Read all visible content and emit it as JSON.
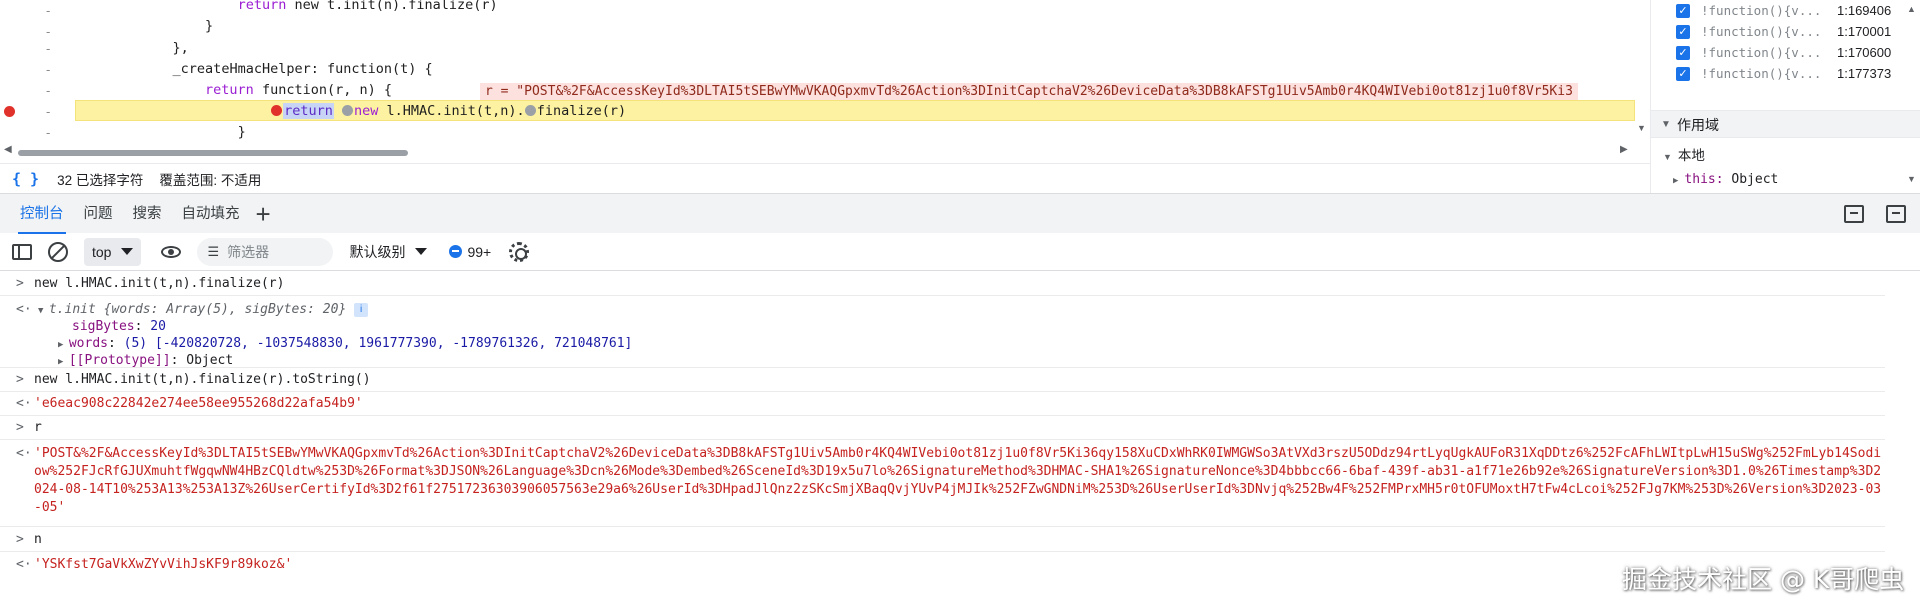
{
  "editor": {
    "lines": [
      {
        "code_pre": "                    ",
        "kw": "return",
        "code_post": " new t.init(n).finalize(r)"
      },
      {
        "code_pre": "                ",
        "kw": "",
        "code_post": "}"
      },
      {
        "code_pre": "            ",
        "kw": "",
        "code_post": "},"
      },
      {
        "code_pre": "            ",
        "kw": "",
        "code_post": "_createHmacHelper: function(t) {"
      },
      {
        "code_pre": "                ",
        "kw": "return",
        "code_post": " function(r, n) {"
      },
      {
        "code_pre": "",
        "kw": "",
        "code_post": "}"
      }
    ],
    "inline_value": "r = \"POST&%2F&AccessKeyId%3DLTAI5tSEBwYMwVKAQGpxmvTd%26Action%3DInitCaptchaV2%26DeviceData%3DB8kAFSTg1Uiv5Amb0r4KQ4WIVebi0ot81zj1u0f8Vr5Ki3",
    "current_line": {
      "kw": "return",
      "part1": "new",
      "part2": " l.HMAC.init(t,n).",
      "part3": "finalize(r)"
    },
    "gutter_dash": "-"
  },
  "status": {
    "selection": "32 已选择字符",
    "coverage": "覆盖范围: 不适用"
  },
  "call_stack": [
    {
      "fn": "!function(){v...",
      "loc": "1:169406"
    },
    {
      "fn": "!function(){v...",
      "loc": "1:170001"
    },
    {
      "fn": "!function(){v...",
      "loc": "1:170600"
    },
    {
      "fn": "!function(){v...",
      "loc": "1:177373"
    }
  ],
  "scope": {
    "header": "作用域",
    "local_label": "本地",
    "this_key": "this:",
    "this_value": "Object"
  },
  "drawer_tabs": [
    "控制台",
    "问题",
    "搜索",
    "自动填充"
  ],
  "toolbar": {
    "context": "top",
    "filter_placeholder": "筛选器",
    "level": "默认级别",
    "issues_count": "99+"
  },
  "console": {
    "cmd1": "new l.HMAC.init(t,n).finalize(r)",
    "res1_head_name": "t.init",
    "res1_head_preview": " {words: Array(5), sigBytes: 20}",
    "res1_info": "i",
    "res1_sigbytes_key": "sigBytes",
    "res1_sigbytes_val": "20",
    "res1_words_key": "words",
    "res1_words_val": "(5) [-420820728, -1037548830, 1961777390, -1789761326, 721048761]",
    "res1_proto_key": "[[Prototype]]",
    "res1_proto_val": "Object",
    "cmd2": "new l.HMAC.init(t,n).finalize(r).toString()",
    "res2": "'e6eac908c22842e274ee58ee955268d22afa54b9'",
    "cmd3": "r",
    "res3": "'POST&%2F&AccessKeyId%3DLTAI5tSEBwYMwVKAQGpxmvTd%26Action%3DInitCaptchaV2%26DeviceData%3DB8kAFSTg1Uiv5Amb0r4KQ4WIVebi0ot81zj1u0f8Vr5Ki36qy158XuCDxWhRK0IWMGWSo3AtVXd3rszU5ODdz94rtLyqUgkAUFoR31XqDDtz6%252FcAFhLWItpLwH15uSWg%252FmLyb14Sodiow%252FJcRfGJUXmuhtfWgqwNW4HBzCQldtw%253D%26Format%3DJSON%26Language%3Dcn%26Mode%3Dembed%26SceneId%3D19x5u7lo%26SignatureMethod%3DHMAC-SHA1%26SignatureNonce%3D4bbbcc66-6baf-439f-ab31-a1f71e26b92e%26SignatureVersion%3D1.0%26Timestamp%3D2024-08-14T10%253A13%253A13Z%26UserCertifyId%3D2f61f27517236303906057563e29a6%26UserId%3DHpadJlQnz2zSKcSmjXBaqQvjYUvP4jMJIk%252FZwGNDNiM%253D%26UserUserId%3DNvjq%252Bw4F%252FMPrxMH5r0tOFUMoxtH7tFw4cLcoi%252FJg7KM%253D%26Version%3D2023-03-05'",
    "cmd4": "n",
    "res4": "'YSKfst7GaVkXwZYvVihJsKF9r89koz&'"
  },
  "watermark": "掘金技术社区 @ K哥爬虫"
}
